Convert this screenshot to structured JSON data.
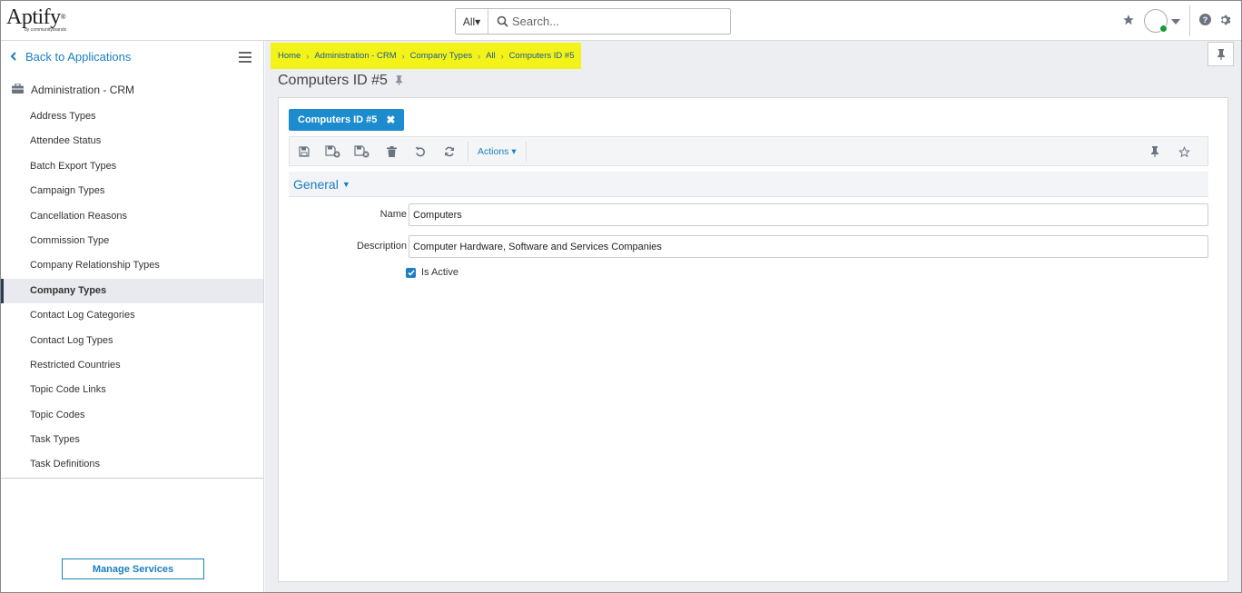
{
  "header": {
    "logo_text": "Aptify",
    "logo_sub": "by communitybrands",
    "search_scope": "All▾",
    "search_placeholder": "Search...",
    "colors": {
      "accent": "#1a7fc1",
      "status_online": "#1a9a3c"
    }
  },
  "sidebar": {
    "back_label": "Back to Applications",
    "section_title": "Administration - CRM",
    "items": [
      {
        "label": "Address Types"
      },
      {
        "label": "Attendee Status"
      },
      {
        "label": "Batch Export Types"
      },
      {
        "label": "Campaign Types"
      },
      {
        "label": "Cancellation Reasons"
      },
      {
        "label": "Commission Type"
      },
      {
        "label": "Company Relationship Types"
      },
      {
        "label": "Company Types"
      },
      {
        "label": "Contact Log Categories"
      },
      {
        "label": "Contact Log Types"
      },
      {
        "label": "Restricted Countries"
      },
      {
        "label": "Topic Code Links"
      },
      {
        "label": "Topic Codes"
      },
      {
        "label": "Task Types"
      },
      {
        "label": "Task Definitions"
      }
    ],
    "active_item": "Company Types",
    "manage_label": "Manage Services"
  },
  "breadcrumb": [
    "Home",
    "Administration - CRM",
    "Company Types",
    "All",
    "Computers ID #5"
  ],
  "page": {
    "title": "Computers ID #5",
    "tab_label": "Computers ID #5",
    "actions_label": "Actions ▾",
    "section_label": "General",
    "name_label": "Name",
    "name_value": "Computers",
    "description_label": "Description",
    "description_value": "Computer Hardware, Software and Services Companies",
    "is_active_label": "Is Active",
    "is_active": true
  }
}
